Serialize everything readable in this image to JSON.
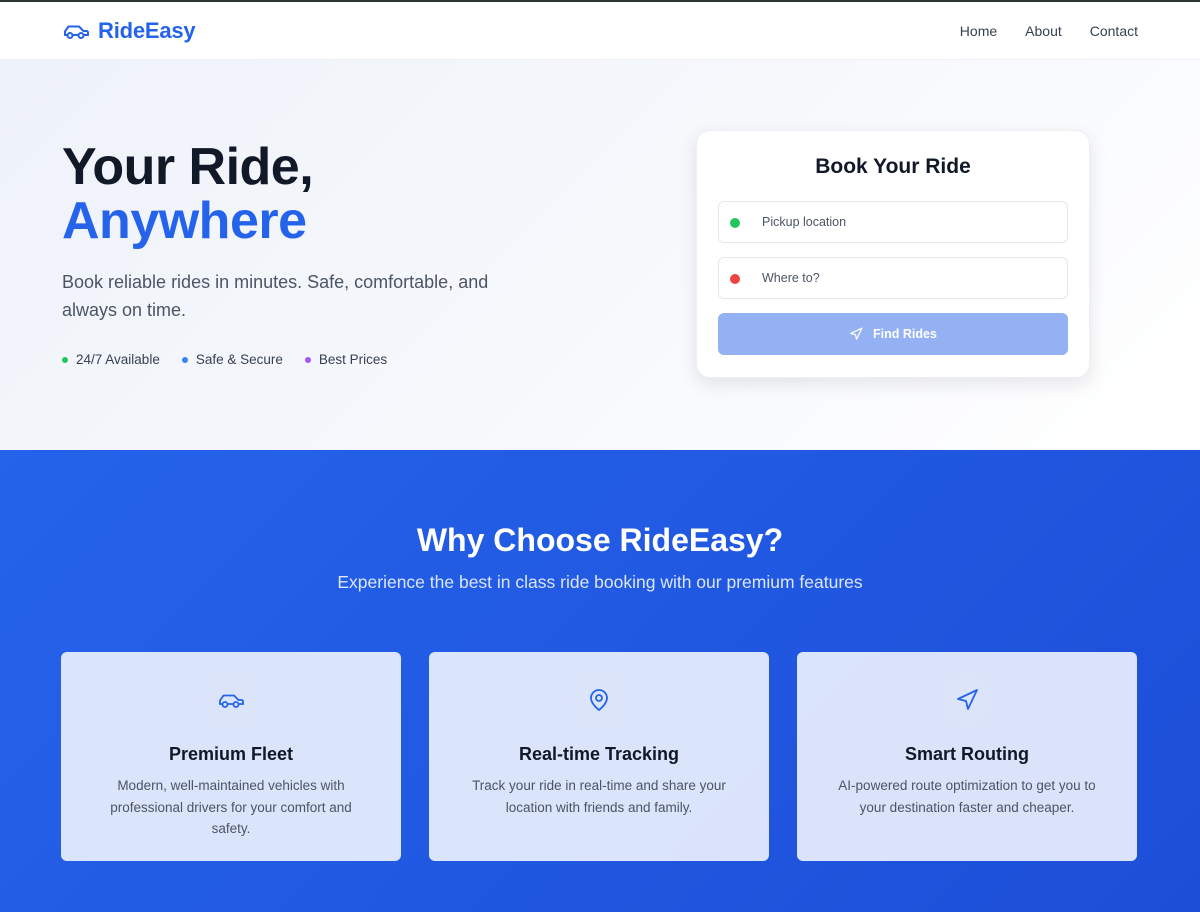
{
  "nav": {
    "brand": "RideEasy",
    "brand_icon": "car-icon",
    "links": [
      "Home",
      "About",
      "Contact"
    ]
  },
  "hero": {
    "title_line1": "Your Ride,",
    "title_line2": "Anywhere",
    "subtitle": "Book reliable rides in minutes. Safe, comfortable, and always on time.",
    "badges": [
      {
        "label": "24/7 Available",
        "color": "#22c55e"
      },
      {
        "label": "Safe & Secure",
        "color": "#3b82f6"
      },
      {
        "label": "Best Prices",
        "color": "#a855f7"
      }
    ]
  },
  "booking": {
    "title": "Book Your Ride",
    "pickup": {
      "placeholder": "Pickup location",
      "value": "",
      "dot_color": "#22c55e"
    },
    "destination": {
      "placeholder": "Where to?",
      "value": "",
      "dot_color": "#ef4444"
    },
    "button_label": "Find Rides",
    "button_icon": "navigation-icon"
  },
  "features": {
    "title": "Why Choose RideEasy?",
    "subtitle": "Experience the best in class ride booking with our premium features",
    "items": [
      {
        "icon": "car-icon",
        "title": "Premium Fleet",
        "description": "Modern, well-maintained vehicles with professional drivers for your comfort and safety."
      },
      {
        "icon": "map-pin-icon",
        "title": "Real-time Tracking",
        "description": "Track your ride in real-time and share your location with friends and family."
      },
      {
        "icon": "navigation-icon",
        "title": "Smart Routing",
        "description": "AI-powered route optimization to get you to your destination faster and cheaper."
      }
    ]
  },
  "colors": {
    "brand": "#2563eb",
    "features_bg": "#1d4ed8",
    "button_disabled": "#93b1f3"
  }
}
